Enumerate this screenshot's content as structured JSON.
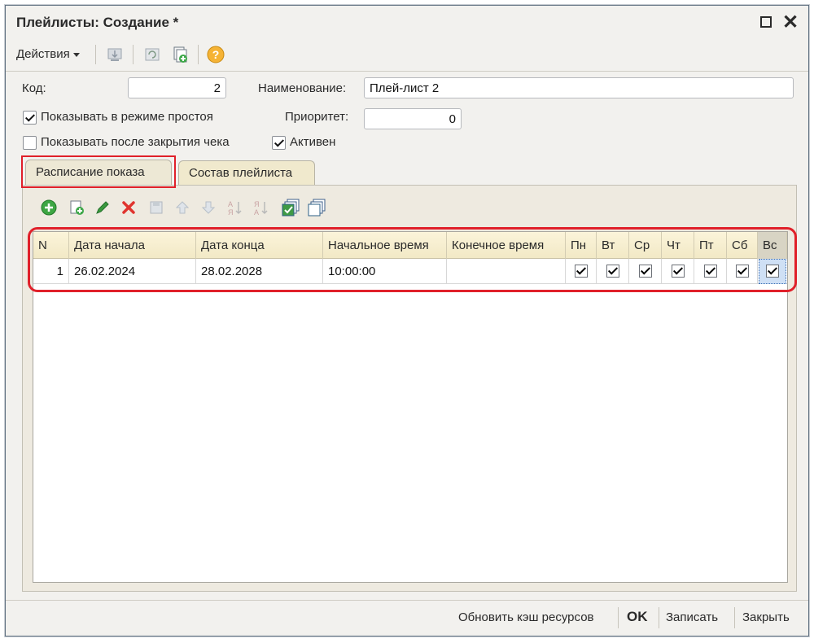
{
  "window": {
    "title": "Плейлисты: Создание *"
  },
  "toolbar": {
    "actions_label": "Действия",
    "icons": [
      "move-icon",
      "refresh-icon",
      "copy-document-icon",
      "help-icon"
    ],
    "help_glyph": "?"
  },
  "form": {
    "code_label": "Код:",
    "code_value": "2",
    "name_label": "Наименование:",
    "name_value": "Плей-лист 2",
    "show_idle_label": "Показывать в режиме простоя",
    "show_idle_checked": true,
    "priority_label": "Приоритет:",
    "priority_value": "0",
    "show_after_receipt_label": "Показывать после закрытия чека",
    "show_after_receipt_checked": false,
    "active_label": "Активен",
    "active_checked": true
  },
  "tabs": [
    {
      "label": "Расписание показа",
      "active": true
    },
    {
      "label": "Состав плейлиста",
      "active": false
    }
  ],
  "grid": {
    "toolbar_icons": [
      "add-icon",
      "copy-row-icon",
      "edit-icon",
      "delete-icon",
      "save-icon",
      "move-up-icon",
      "move-down-icon",
      "sort-asc-icon",
      "sort-desc-icon",
      "check-all-icon",
      "uncheck-all-icon"
    ],
    "columns": [
      "N",
      "Дата начала",
      "Дата конца",
      "Начальное время",
      "Конечное время",
      "Пн",
      "Вт",
      "Ср",
      "Чт",
      "Пт",
      "Сб",
      "Вс"
    ],
    "rows": [
      {
        "n": "1",
        "start_date": "26.02.2024",
        "end_date": "28.02.2028",
        "start_time": "10:00:00",
        "end_time": "",
        "days": [
          true,
          true,
          true,
          true,
          true,
          true,
          true
        ]
      }
    ]
  },
  "footer": {
    "refresh_cache_label": "Обновить кэш ресурсов",
    "ok_label": "OK",
    "save_label": "Записать",
    "close_label": "Закрыть"
  },
  "colors": {
    "highlight": "#e0202a",
    "header_bg": "#f2e9c6",
    "window_bg": "#f2f1ee"
  }
}
